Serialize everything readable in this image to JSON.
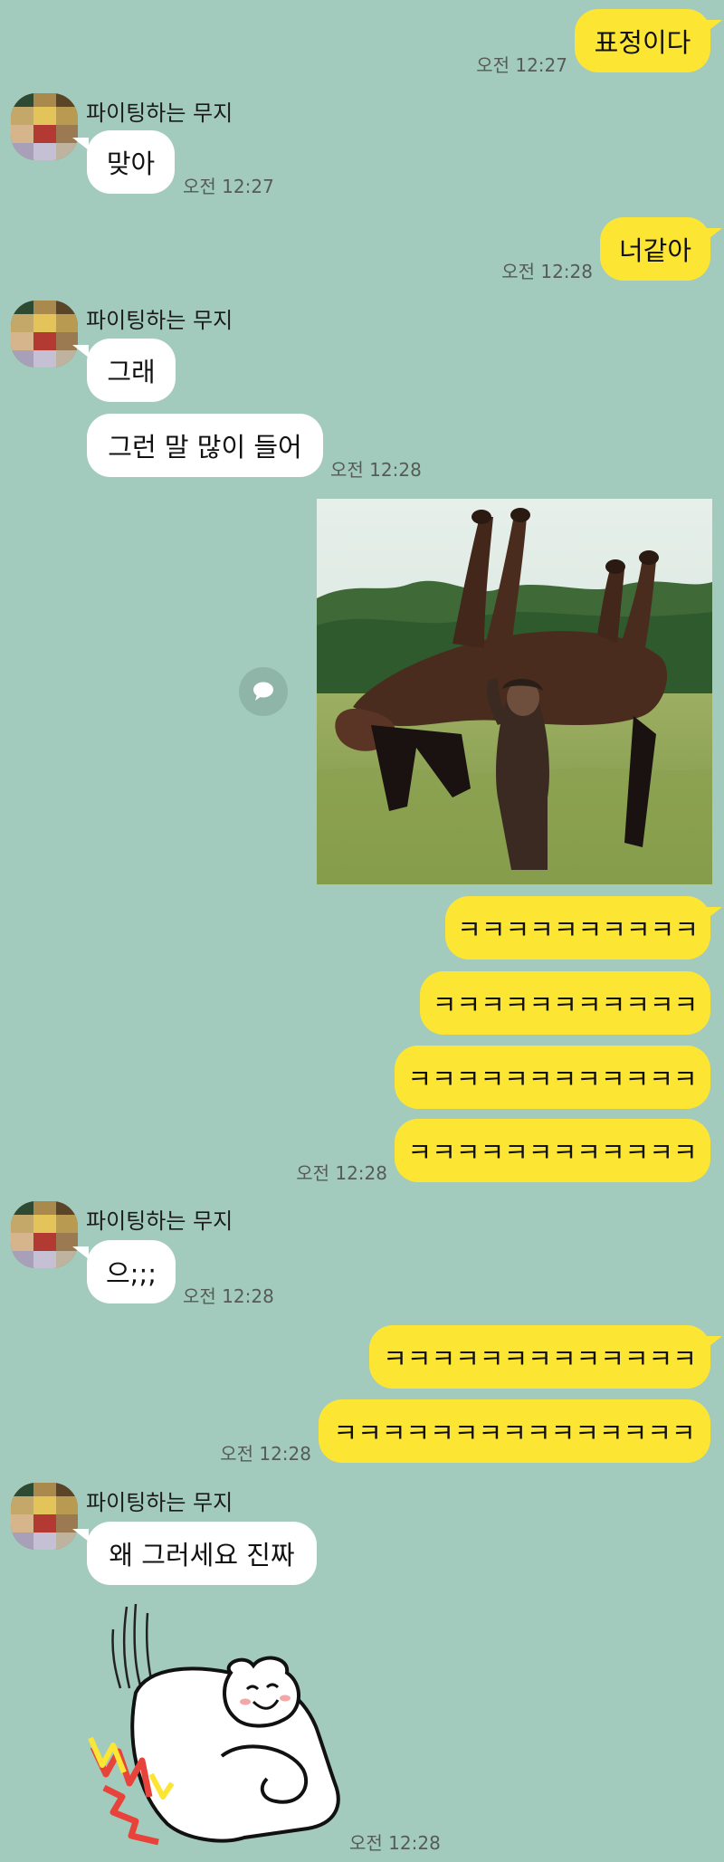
{
  "chat": {
    "partner_name": "파이팅하는 무지",
    "messages": {
      "m1": {
        "text": "표정이다",
        "time": "오전 12:27"
      },
      "m2": {
        "text": "맞아",
        "time": "오전 12:27"
      },
      "m3": {
        "text": "너같아",
        "time": "오전 12:28"
      },
      "m4": {
        "text": "그래"
      },
      "m5": {
        "text": "그런 말 많이 들어",
        "time": "오전 12:28"
      },
      "m7": {
        "text": "ㅋㅋㅋㅋㅋㅋㅋㅋㅋㅋ"
      },
      "m8": {
        "text": "ㅋㅋㅋㅋㅋㅋㅋㅋㅋㅋㅋ"
      },
      "m9": {
        "text": "ㅋㅋㅋㅋㅋㅋㅋㅋㅋㅋㅋㅋ"
      },
      "m10": {
        "text": "ㅋㅋㅋㅋㅋㅋㅋㅋㅋㅋㅋㅋ",
        "time": "오전 12:28"
      },
      "m11": {
        "text": "으;;;",
        "time": "오전 12:28"
      },
      "m12": {
        "text": "ㅋㅋㅋㅋㅋㅋㅋㅋㅋㅋㅋㅋㅋ"
      },
      "m13": {
        "text": "ㅋㅋㅋㅋㅋㅋㅋㅋㅋㅋㅋㅋㅋㅋㅋ",
        "time": "오전 12:28"
      },
      "m14": {
        "text": "왜 그러세요 진짜"
      },
      "m15": {
        "time": "오전 12:28"
      }
    }
  },
  "colors": {
    "background": "#a3cbbd",
    "my_bubble": "#fde533",
    "their_bubble": "#ffffff"
  },
  "icons": {
    "share": "speech-bubble-icon"
  }
}
